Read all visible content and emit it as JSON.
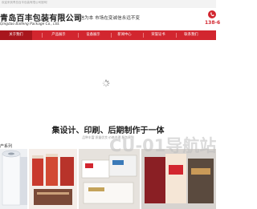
{
  "topbar": {
    "text": "欢迎来到青岛百丰包装有限公司官网！"
  },
  "header": {
    "company_name_cn": "青岛百丰包装有限公司",
    "company_name_en": "Qingdao Baifeng Package Co., Ltd.",
    "slogan": "诚信为本 市场在变诚信永远不变",
    "phone_partial": "138-6"
  },
  "nav": {
    "items": [
      {
        "label": "关于我们",
        "active": true
      },
      {
        "label": "产品展示",
        "active": false
      },
      {
        "label": "设备展示",
        "active": false
      },
      {
        "label": "新闻中心",
        "active": false
      },
      {
        "label": "荣誉证书",
        "active": false
      },
      {
        "label": "联系我们",
        "active": false
      }
    ]
  },
  "main": {
    "headline": "集设计、印刷、后期制作于一体",
    "subline": "品种丰富 质量优良 价格合理 服务周到"
  },
  "products": {
    "section_title": "产系列"
  },
  "watermark": {
    "text": "CU-01导航站"
  },
  "colors": {
    "brand_red": "#d2262f",
    "nav_active": "#a8161d"
  }
}
